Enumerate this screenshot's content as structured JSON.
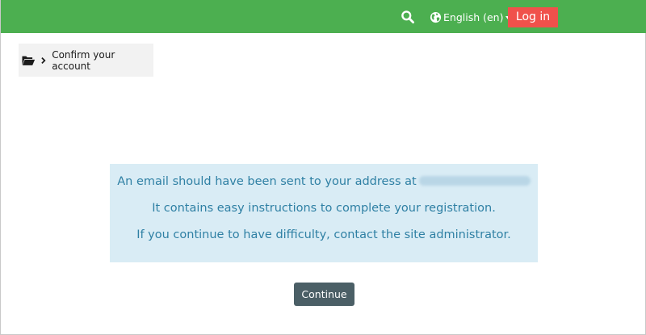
{
  "navbar": {
    "background": "#4caf50",
    "search_icon": "search-icon",
    "language_icon": "globe-icon",
    "language_label": "English (en)",
    "login_label": "Log in",
    "login_color": "#f0514b"
  },
  "breadcrumb": {
    "home_icon": "folder-open-icon",
    "separator_icon": "chevron-right-icon",
    "current": "Confirm your account"
  },
  "alert": {
    "background": "#d9ecf5",
    "text_color": "#2f80a4",
    "line1": "An email should have been sent to your address at",
    "email_redacted": true,
    "line2": "It contains easy instructions to complete your registration.",
    "line3": "If you continue to have difficulty, contact the site administrator."
  },
  "actions": {
    "continue_label": "Continue",
    "continue_color": "#4b5f66"
  }
}
